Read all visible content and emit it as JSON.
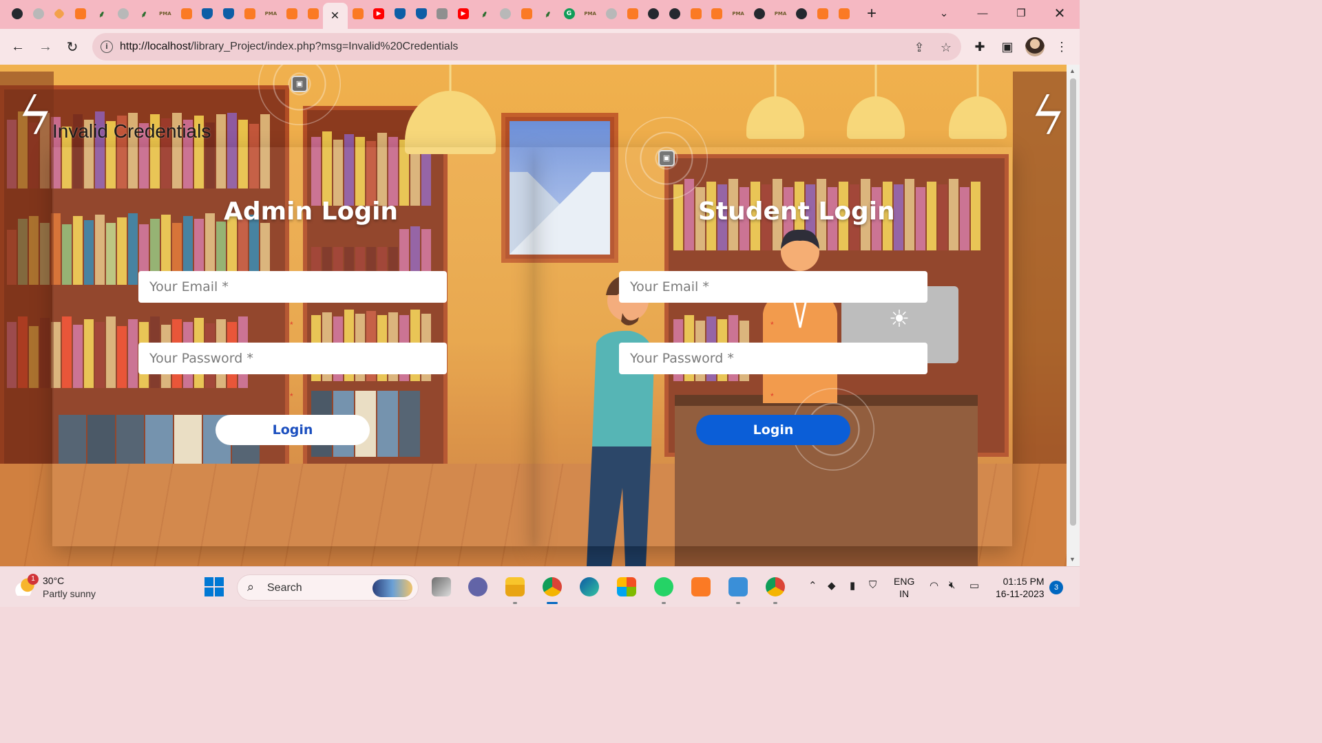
{
  "browser": {
    "tabs": [
      {
        "icon": "github-icon",
        "kind": "github"
      },
      {
        "icon": "gray-globe-icon",
        "kind": "gray"
      },
      {
        "icon": "diamond-icon",
        "kind": "diamond"
      },
      {
        "icon": "xampp-icon",
        "kind": "xampp"
      },
      {
        "icon": "leaf-icon",
        "kind": "leaf"
      },
      {
        "icon": "gray-globe-icon",
        "kind": "gray"
      },
      {
        "icon": "leaf-icon",
        "kind": "leaf"
      },
      {
        "icon": "phpmyadmin-icon",
        "kind": "pma"
      },
      {
        "icon": "xampp-icon",
        "kind": "xampp"
      },
      {
        "icon": "shield-icon",
        "kind": "shield"
      },
      {
        "icon": "shield-icon",
        "kind": "shield"
      },
      {
        "icon": "xampp-icon",
        "kind": "xampp"
      },
      {
        "icon": "phpmyadmin-icon",
        "kind": "pma"
      },
      {
        "icon": "xampp-icon",
        "kind": "xampp"
      },
      {
        "icon": "xampp-icon",
        "kind": "xampp"
      },
      {
        "icon": "active-tab-close-icon",
        "kind": "active"
      },
      {
        "icon": "xampp-icon",
        "kind": "xampp"
      },
      {
        "icon": "youtube-icon",
        "kind": "youtube"
      },
      {
        "icon": "shield-icon",
        "kind": "shield"
      },
      {
        "icon": "shield-icon",
        "kind": "shield"
      },
      {
        "icon": "grid-icon",
        "kind": "grid"
      },
      {
        "icon": "youtube-icon",
        "kind": "youtube"
      },
      {
        "icon": "leaf-icon",
        "kind": "leaf"
      },
      {
        "icon": "gray-globe-icon",
        "kind": "gray"
      },
      {
        "icon": "xampp-icon",
        "kind": "xampp"
      },
      {
        "icon": "leaf-icon",
        "kind": "leaf"
      },
      {
        "icon": "grammarly-icon",
        "kind": "green"
      },
      {
        "icon": "phpmyadmin-icon",
        "kind": "pma"
      },
      {
        "icon": "gray-globe-icon",
        "kind": "gray"
      },
      {
        "icon": "xampp-icon",
        "kind": "xampp"
      },
      {
        "icon": "github-icon",
        "kind": "github"
      },
      {
        "icon": "chrome-icon",
        "kind": "github"
      },
      {
        "icon": "xampp-icon",
        "kind": "xampp"
      },
      {
        "icon": "xampp-icon",
        "kind": "xampp"
      },
      {
        "icon": "phpmyadmin-icon",
        "kind": "pma"
      },
      {
        "icon": "github-icon",
        "kind": "github"
      },
      {
        "icon": "phpmyadmin-icon",
        "kind": "pma"
      },
      {
        "icon": "chrome-icon",
        "kind": "github"
      },
      {
        "icon": "xampp-icon",
        "kind": "xampp"
      },
      {
        "icon": "xampp-icon",
        "kind": "xampp"
      }
    ],
    "pma_label": "PMA",
    "url_host": "http://localhost",
    "url_path": "/library_Project/index.php?msg=Invalid%20Credentials"
  },
  "page": {
    "error_message": "Invalid Credentials",
    "admin": {
      "title": "Admin Login",
      "email_placeholder": "Your Email *",
      "password_placeholder": "Your Password *",
      "button_label": "Login"
    },
    "student": {
      "title": "Student Login",
      "email_placeholder": "Your Email *",
      "password_placeholder": "Your Password *",
      "button_label": "Login"
    },
    "required_mark": "*"
  },
  "taskbar": {
    "weather_badge": "1",
    "temperature": "30°C",
    "condition": "Partly sunny",
    "search_label": "Search",
    "language_line1": "ENG",
    "language_line2": "IN",
    "time": "01:15 PM",
    "date": "16-11-2023",
    "notification_count": "3"
  },
  "colors": {
    "tabstrip": "#f5b8c2",
    "student_button": "#0b5ed7",
    "admin_button_text": "#1b4fbf"
  }
}
